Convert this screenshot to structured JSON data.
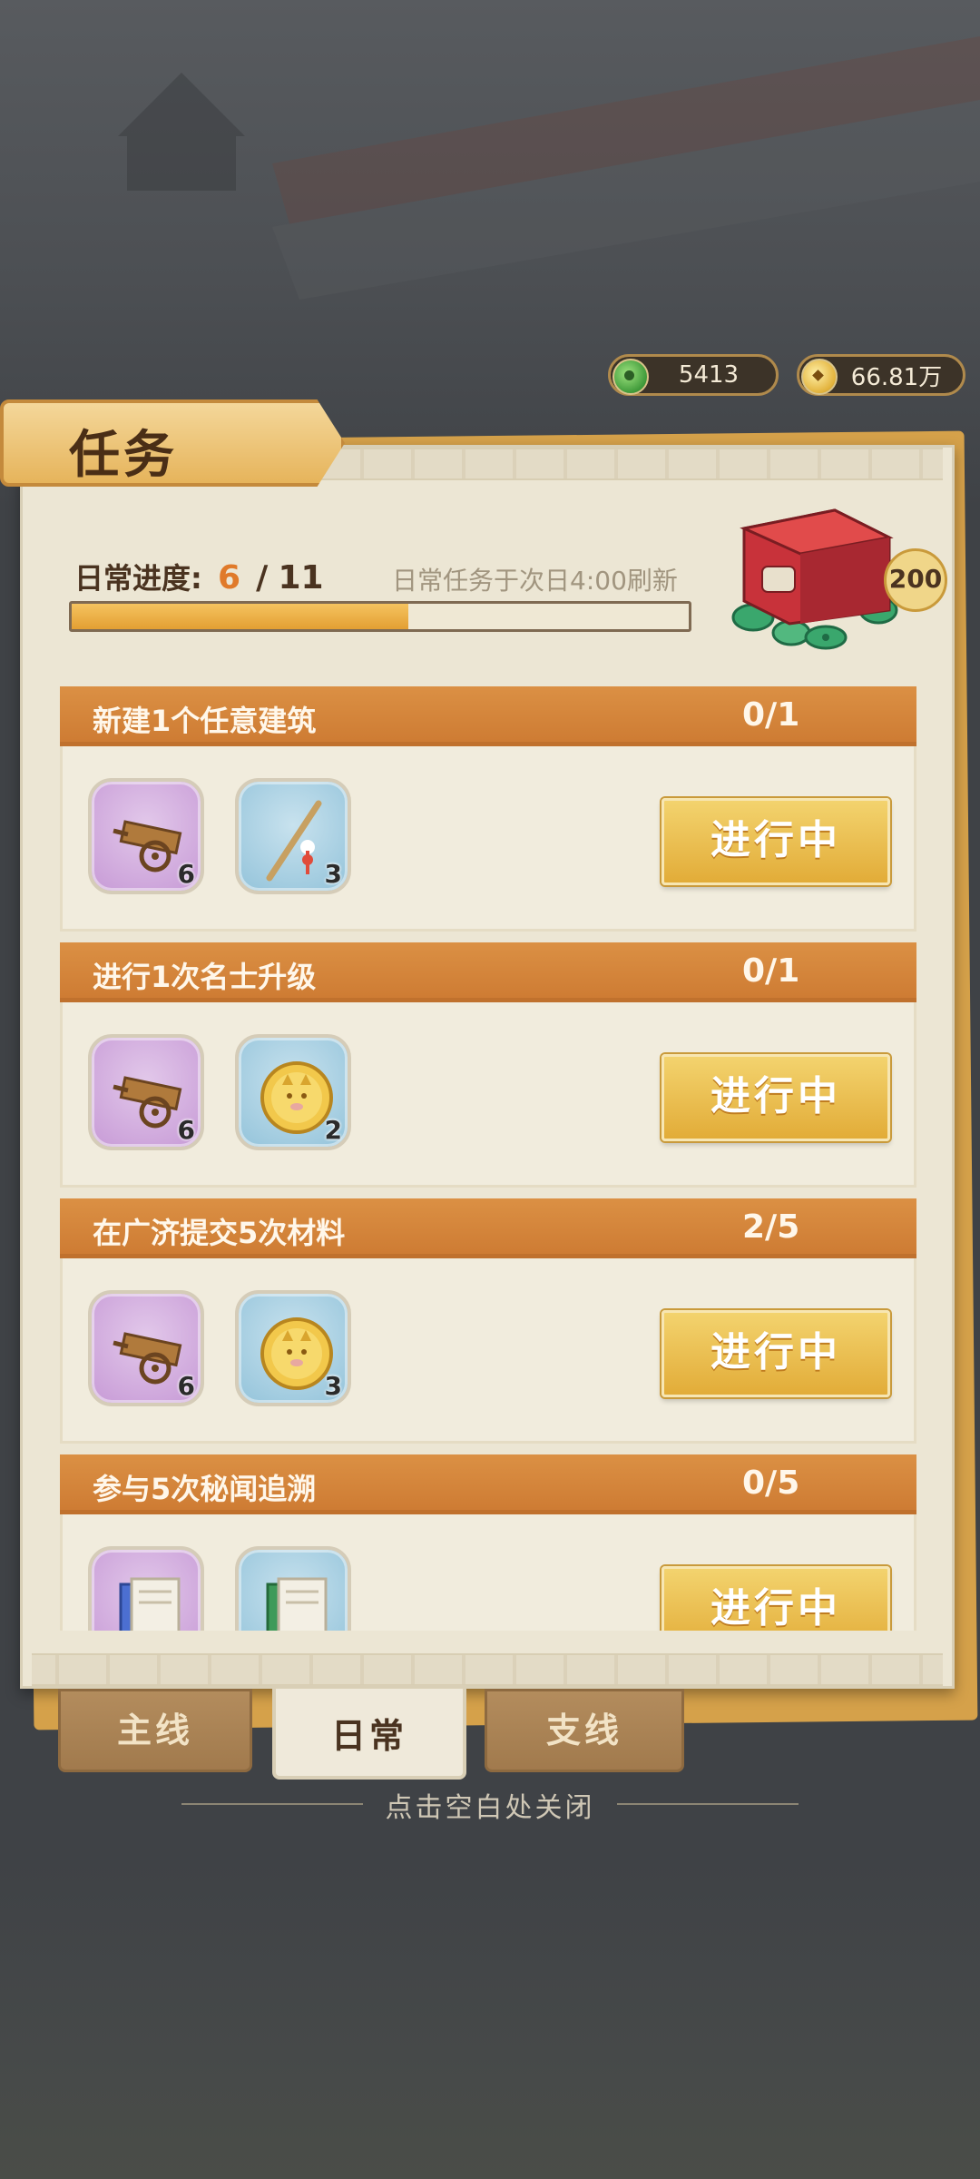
{
  "currencies": {
    "jade": {
      "value": "5413",
      "icon": "jade-coin-icon"
    },
    "coin": {
      "value": "66.81万",
      "icon": "copper-coin-icon"
    }
  },
  "panel": {
    "title": "任务"
  },
  "progress": {
    "label": "日常进度:",
    "current": "6",
    "separator": "/",
    "total": "11",
    "fraction": 0.545,
    "refresh_note": "日常任务于次日4:00刷新",
    "chest_badge": "200"
  },
  "tasks": [
    {
      "name": "新建1个任意建筑",
      "count": "0/1",
      "rewards": [
        {
          "icon": "cart-icon",
          "qty": "6",
          "bg": "purple"
        },
        {
          "icon": "fishing-rod-icon",
          "qty": "3",
          "bg": "blue"
        }
      ],
      "button": "进行中"
    },
    {
      "name": "进行1次名士升级",
      "count": "0/1",
      "rewards": [
        {
          "icon": "cart-icon",
          "qty": "6",
          "bg": "purple"
        },
        {
          "icon": "gold-cat-coin-icon",
          "qty": "2",
          "bg": "blue"
        }
      ],
      "button": "进行中"
    },
    {
      "name": "在广济提交5次材料",
      "count": "2/5",
      "rewards": [
        {
          "icon": "cart-icon",
          "qty": "6",
          "bg": "purple"
        },
        {
          "icon": "gold-cat-coin-icon",
          "qty": "3",
          "bg": "blue"
        }
      ],
      "button": "进行中"
    },
    {
      "name": "参与5次秘闻追溯",
      "count": "0/5",
      "rewards": [
        {
          "icon": "blue-book-icon",
          "qty": "",
          "bg": "purple"
        },
        {
          "icon": "green-book-icon",
          "qty": "",
          "bg": "blue"
        }
      ],
      "button": "进行中"
    }
  ],
  "tabs": [
    {
      "label": "主线",
      "active": false
    },
    {
      "label": "日常",
      "active": true
    },
    {
      "label": "支线",
      "active": false
    }
  ],
  "close_hint": "点击空白处关闭",
  "colors": {
    "accent": "#d98a3c",
    "button": "#e9b846",
    "panel": "#ece6d4"
  }
}
